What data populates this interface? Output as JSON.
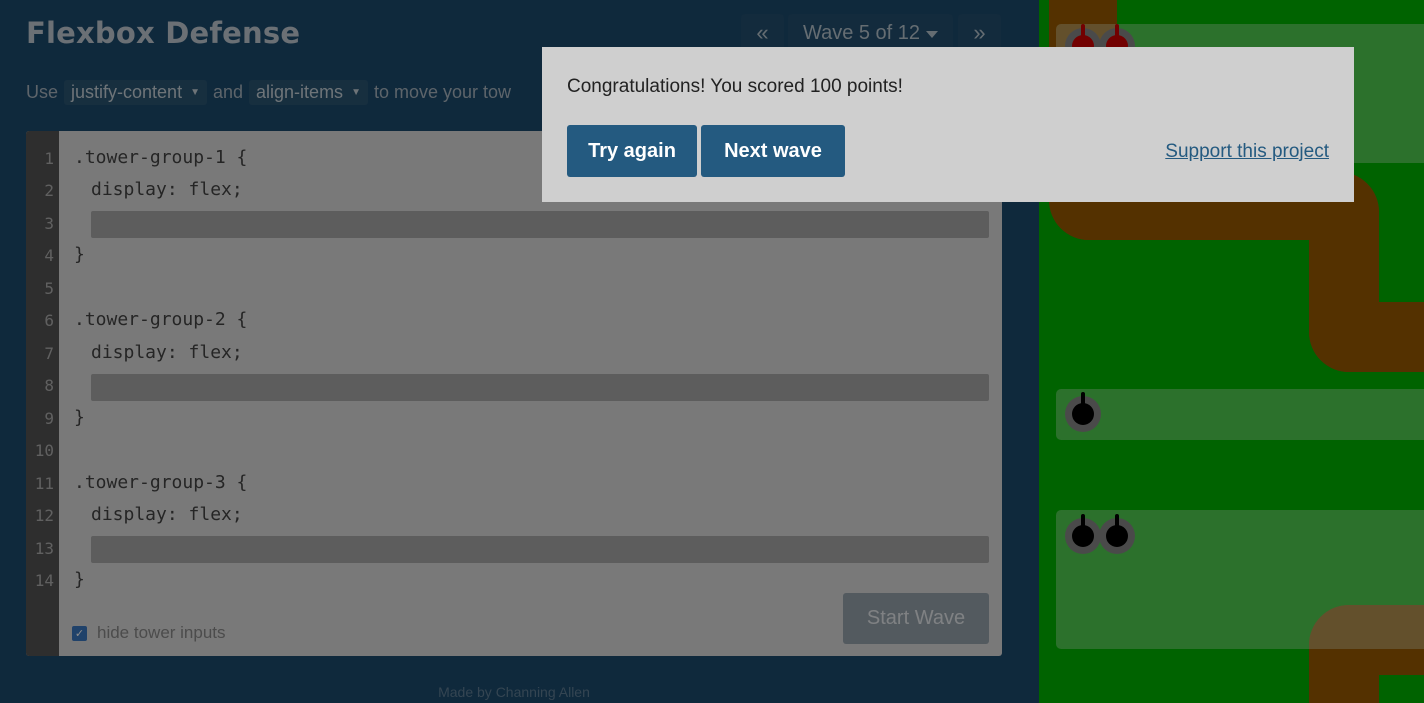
{
  "header": {
    "title": "Flexbox Defense",
    "prev_label": "«",
    "wave_label": "Wave 5 of 12",
    "next_label": "»"
  },
  "instructions": {
    "prefix": "Use",
    "prop1": "justify-content",
    "conj": "and",
    "prop2": "align-items",
    "suffix": "to move your tow"
  },
  "editor": {
    "line_numbers": [
      "1",
      "2",
      "3",
      "4",
      "5",
      "6",
      "7",
      "8",
      "9",
      "10",
      "11",
      "12",
      "13",
      "14"
    ],
    "lines": {
      "l1": ".tower-group-1 {",
      "l2": "display: flex;",
      "l4": "}",
      "l6": ".tower-group-2 {",
      "l7": "display: flex;",
      "l9": "}",
      "l11": ".tower-group-3 {",
      "l12": "display: flex;",
      "l14": "}"
    },
    "hide_inputs_label": "hide tower inputs",
    "hide_inputs_checked": true,
    "start_label": "Start Wave"
  },
  "footer": {
    "credit": "Made by Channing Allen"
  },
  "modal": {
    "message": "Congratulations! You scored 100 points!",
    "try_again": "Try again",
    "next_wave": "Next wave",
    "support": "Support this project"
  },
  "colors": {
    "panel": "#1d4b6e",
    "board_green": "#00b400",
    "path_brown": "#9a5a00",
    "button_blue": "#245a80"
  }
}
